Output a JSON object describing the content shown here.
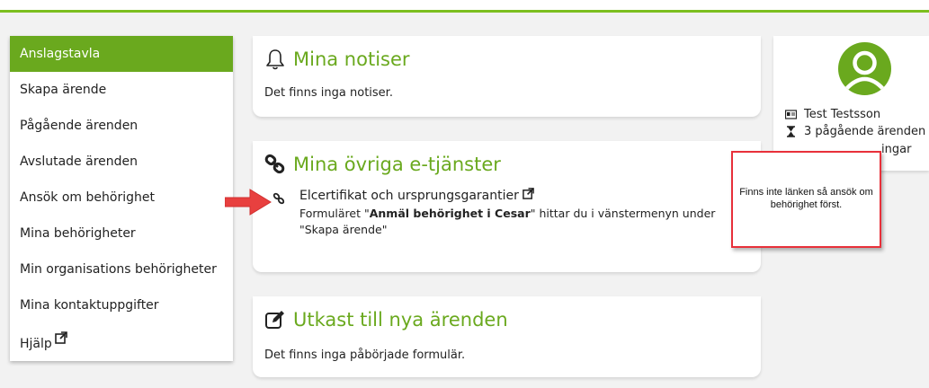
{
  "sidebar": {
    "items": [
      {
        "label": "Anslagstavla",
        "active": true
      },
      {
        "label": "Skapa ärende"
      },
      {
        "label": "Pågående ärenden"
      },
      {
        "label": "Avslutade ärenden"
      },
      {
        "label": "Ansök om behörighet"
      },
      {
        "label": "Mina behörigheter"
      },
      {
        "label": "Min organisations behörigheter"
      },
      {
        "label": "Mina kontaktuppgifter"
      },
      {
        "label": "Hjälp",
        "icon": "external-link-icon"
      }
    ]
  },
  "notices": {
    "title": "Mina notiser",
    "icon": "bell-icon",
    "empty_text": "Det finns inga notiser."
  },
  "services": {
    "title": "Mina övriga e-tjänster",
    "icon": "link-icon",
    "items": [
      {
        "name": "Elcertifikat och ursprungsgarantier",
        "icon": "external-link-icon",
        "desc_before": "Formuläret \"",
        "desc_bold": "Anmäl behörighet i Cesar",
        "desc_after": "\" hittar du i vänstermenyn under \"Skapa ärende\""
      }
    ]
  },
  "drafts": {
    "title": "Utkast till nya ärenden",
    "icon": "edit-icon",
    "empty_text": "Det finns inga påbörjade formulär."
  },
  "profile": {
    "name": "Test Testsson",
    "ongoing": "3 pågående ärenden",
    "partial": "ingar"
  },
  "callout": {
    "text": "Finns inte länken så ansök om behörighet först."
  },
  "colors": {
    "accent": "#6aa91e",
    "top_border": "#7cbf1f",
    "callout_border": "#e8303a",
    "arrow": "#e8403f"
  }
}
